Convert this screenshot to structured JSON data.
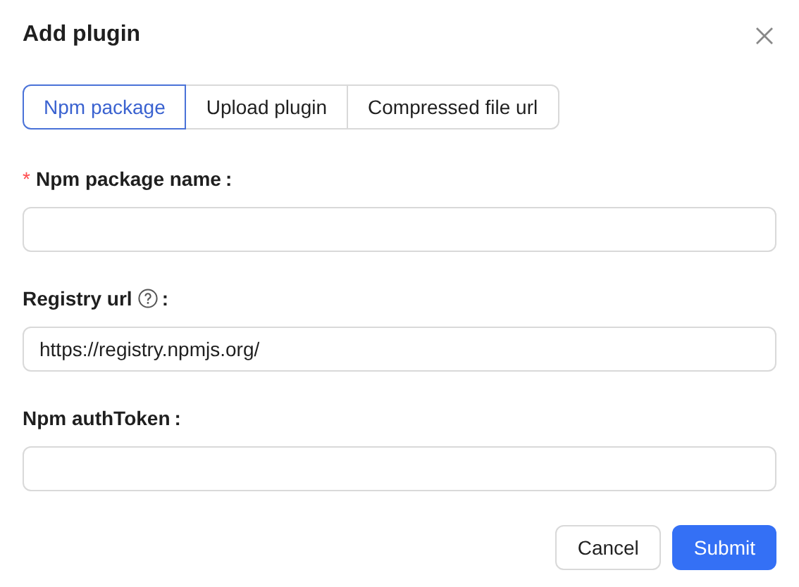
{
  "dialog": {
    "title": "Add plugin"
  },
  "tabs": [
    {
      "label": "Npm package",
      "selected": true
    },
    {
      "label": "Upload plugin",
      "selected": false
    },
    {
      "label": "Compressed file url",
      "selected": false
    }
  ],
  "fields": [
    {
      "label": "Npm package name",
      "required_mark": "*",
      "help": false,
      "colon": ":"
    },
    {
      "label": "Registry url",
      "help": true,
      "colon": ":",
      "value": "https://registry.npmjs.org/"
    },
    {
      "label": "Npm authToken",
      "help": false,
      "colon": ":"
    }
  ],
  "buttons": [
    {
      "label": "Cancel",
      "kind": "default"
    },
    {
      "label": "Submit",
      "kind": "primary"
    }
  ]
}
